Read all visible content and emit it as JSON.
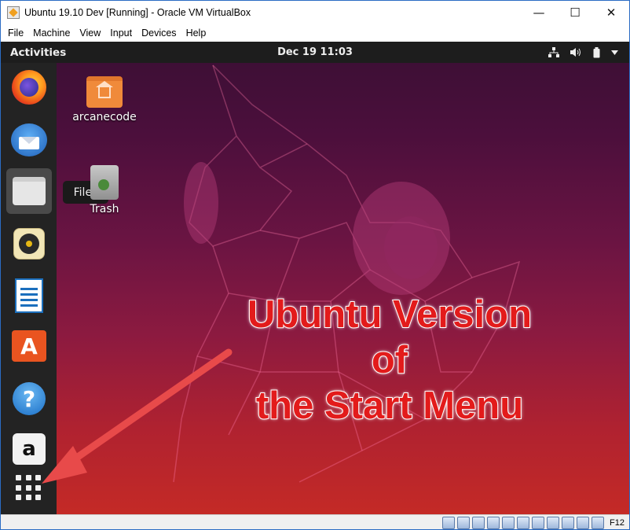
{
  "window": {
    "title": "Ubuntu 19.10 Dev [Running] - Oracle VM VirtualBox",
    "minimize": "—",
    "maximize": "☐",
    "close": "✕"
  },
  "menubar": [
    "File",
    "Machine",
    "View",
    "Input",
    "Devices",
    "Help"
  ],
  "topbar": {
    "activities": "Activities",
    "clock": "Dec 19  11:03"
  },
  "dock": {
    "items": [
      "firefox",
      "thunderbird",
      "files",
      "rhythmbox",
      "libreoffice-writer",
      "ubuntu-software",
      "help",
      "amazon",
      "show-applications"
    ],
    "active": "files",
    "tooltip": "Files"
  },
  "desktop": {
    "icons": [
      {
        "label": "arcanecode",
        "icon": "home-folder-icon"
      },
      {
        "label": "Trash",
        "icon": "trash-icon"
      }
    ]
  },
  "annotation": {
    "line1": "Ubuntu Version of",
    "line2": "the Start Menu",
    "color": "#e31b1b"
  },
  "statusbar": {
    "hostkey": "F12"
  },
  "colors": {
    "accent": "#e95420",
    "arrow": "#e84a4a"
  }
}
